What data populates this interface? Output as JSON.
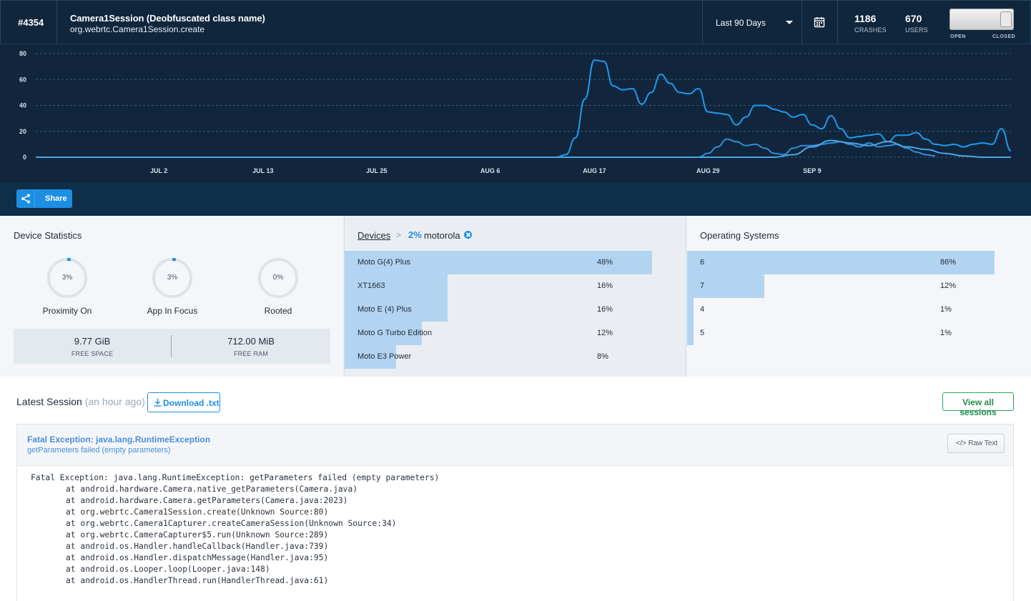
{
  "header": {
    "issue_number": "#4354",
    "title": "Camera1Session (Deobfuscated class name)",
    "subtitle": "org.webrtc.Camera1Session.create",
    "range_label": "Last 90 Days",
    "crashes": "1186",
    "crashes_label": "CRASHES",
    "users": "670",
    "users_label": "USERS",
    "toggle_open": "OPEN",
    "toggle_closed": "CLOSED",
    "toggle_state": "closed"
  },
  "chart_data": {
    "type": "line",
    "ylim": [
      0,
      80
    ],
    "yticks": [
      "0",
      "20",
      "40",
      "60",
      "80"
    ],
    "xticks": [
      "JUL 2",
      "JUL 13",
      "JUL 25",
      "AUG 6",
      "AUG 17",
      "AUG 29",
      "SEP 9"
    ],
    "grid": true,
    "series": [
      {
        "color": "#1d9bf0",
        "points": [
          [
            0,
            0
          ],
          [
            55,
            0
          ],
          [
            56,
            2
          ],
          [
            57,
            15
          ],
          [
            58,
            45
          ],
          [
            59,
            75
          ],
          [
            60,
            74
          ],
          [
            61,
            55
          ],
          [
            62,
            52
          ],
          [
            63,
            53
          ],
          [
            64,
            41
          ],
          [
            65,
            50
          ],
          [
            66,
            64
          ],
          [
            67,
            57
          ],
          [
            68,
            50
          ],
          [
            69,
            49
          ],
          [
            70,
            53
          ],
          [
            71,
            35
          ],
          [
            72,
            34
          ],
          [
            73,
            33
          ],
          [
            74,
            25
          ],
          [
            75,
            31
          ],
          [
            76,
            40
          ],
          [
            77,
            40
          ],
          [
            78,
            37
          ],
          [
            79,
            35
          ],
          [
            80,
            31
          ],
          [
            81,
            33
          ],
          [
            82,
            25
          ],
          [
            83,
            22
          ],
          [
            84,
            32
          ],
          [
            85,
            22
          ],
          [
            86,
            15
          ],
          [
            87,
            16
          ],
          [
            88,
            17
          ],
          [
            89,
            18
          ],
          [
            90,
            12
          ],
          [
            91,
            17
          ],
          [
            92,
            17
          ],
          [
            93,
            19
          ],
          [
            94,
            14
          ],
          [
            95,
            10
          ],
          [
            96,
            9
          ],
          [
            97,
            10
          ],
          [
            98,
            8
          ],
          [
            99,
            10
          ],
          [
            100,
            11
          ],
          [
            101,
            10
          ],
          [
            102,
            22
          ],
          [
            103,
            5
          ]
        ]
      },
      {
        "color": "#2f8fd8",
        "points": [
          [
            0,
            0
          ],
          [
            70,
            0
          ],
          [
            71,
            3
          ],
          [
            72,
            8
          ],
          [
            73,
            14
          ],
          [
            74,
            12
          ],
          [
            75,
            9
          ],
          [
            76,
            10
          ],
          [
            77,
            7
          ],
          [
            78,
            3
          ],
          [
            79,
            2
          ],
          [
            80,
            7
          ],
          [
            81,
            9
          ],
          [
            82,
            9
          ],
          [
            83,
            10
          ],
          [
            84,
            11
          ],
          [
            85,
            12
          ],
          [
            86,
            10
          ],
          [
            87,
            8
          ],
          [
            88,
            11
          ],
          [
            89,
            8
          ],
          [
            90,
            9
          ],
          [
            91,
            10
          ],
          [
            92,
            7
          ],
          [
            93,
            4
          ],
          [
            94,
            2
          ],
          [
            95,
            1
          ]
        ]
      },
      {
        "color": "#4aa6e8",
        "points": [
          [
            0,
            0
          ],
          [
            78,
            0
          ],
          [
            80,
            2
          ],
          [
            82,
            8
          ],
          [
            84,
            13
          ],
          [
            86,
            11
          ],
          [
            88,
            9
          ],
          [
            90,
            12
          ],
          [
            92,
            8
          ],
          [
            94,
            6
          ],
          [
            96,
            3
          ],
          [
            98,
            1
          ],
          [
            100,
            0
          ],
          [
            103,
            0
          ]
        ]
      }
    ]
  },
  "share": {
    "label": "Share"
  },
  "device_stats": {
    "title": "Device Statistics",
    "rings": [
      {
        "label": "Proximity On",
        "pct_text": "3%",
        "value": 0.03
      },
      {
        "label": "App In Focus",
        "pct_text": "3%",
        "value": 0.03
      },
      {
        "label": "Rooted",
        "pct_text": "0%",
        "value": 0.0
      }
    ],
    "free_space": "9.77 GiB",
    "free_space_label": "FREE SPACE",
    "free_ram": "712.00 MiB",
    "free_ram_label": "FREE RAM"
  },
  "devices": {
    "crumb_root": "Devices",
    "crumb_sep": ">",
    "filter_pct": "2%",
    "filter_name": "motorola",
    "rows": [
      {
        "name": "Moto G(4) Plus",
        "pct_text": "48%",
        "value": 0.48
      },
      {
        "name": "XT1663",
        "pct_text": "16%",
        "value": 0.16
      },
      {
        "name": "Moto E (4) Plus",
        "pct_text": "16%",
        "value": 0.16
      },
      {
        "name": "Moto G Turbo Edition",
        "pct_text": "12%",
        "value": 0.12
      },
      {
        "name": "Moto E3 Power",
        "pct_text": "8%",
        "value": 0.08
      }
    ]
  },
  "os": {
    "title": "Operating Systems",
    "rows": [
      {
        "name": "6",
        "pct_text": "86%",
        "value": 0.86
      },
      {
        "name": "7",
        "pct_text": "12%",
        "value": 0.12
      },
      {
        "name": "4",
        "pct_text": "1%",
        "value": 0.01
      },
      {
        "name": "5",
        "pct_text": "1%",
        "value": 0.01
      }
    ]
  },
  "session": {
    "title": "Latest Session",
    "ago": "(an hour ago)",
    "download_label": "Download .txt",
    "view_all_label": "View all sessions",
    "exception_title": "Fatal Exception: java.lang.RuntimeException",
    "exception_subtitle": "getParameters failed (empty parameters)",
    "raw_text_label": "Raw Text",
    "stack_lines": [
      "Fatal Exception: java.lang.RuntimeException: getParameters failed (empty parameters)",
      "at android.hardware.Camera.native_getParameters(Camera.java)",
      "at android.hardware.Camera.getParameters(Camera.java:2023)",
      "at org.webrtc.Camera1Session.create(Unknown Source:80)",
      "at org.webrtc.Camera1Capturer.createCameraSession(Unknown Source:34)",
      "at org.webrtc.CameraCapturer$5.run(Unknown Source:289)",
      "at android.os.Handler.handleCallback(Handler.java:739)",
      "at android.os.Handler.dispatchMessage(Handler.java:95)",
      "at android.os.Looper.loop(Looper.java:148)",
      "at android.os.HandlerThread.run(HandlerThread.java:61)"
    ]
  }
}
